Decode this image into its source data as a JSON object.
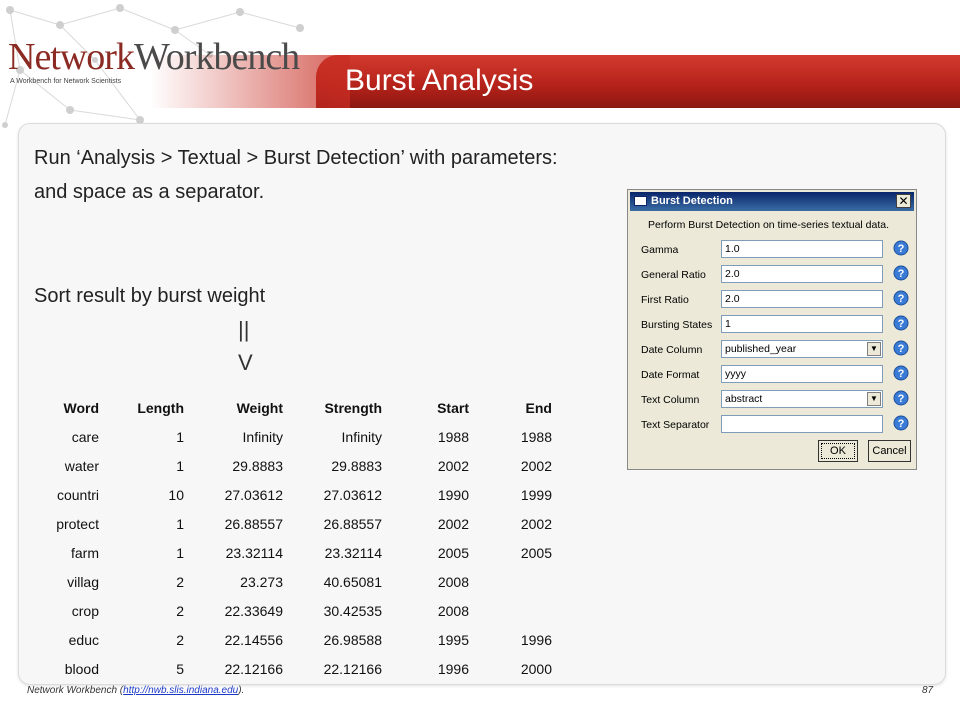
{
  "header": {
    "brand_part_a": "Network",
    "brand_part_b": "Workbench",
    "brand_tagline": "A Workbench for Network Scientists",
    "slide_title": "Burst Analysis"
  },
  "content": {
    "line1": "Run ‘Analysis > Textual > Burst Detection’ with parameters:",
    "line2": "and space as a separator.",
    "line3": "Sort result by burst weight",
    "arrow_top": "||",
    "arrow_bottom": "V"
  },
  "table": {
    "columns": [
      "Word",
      "Length",
      "Weight",
      "Strength",
      "Start",
      "End"
    ],
    "rows": [
      [
        "care",
        "1",
        "Infinity",
        "Infinity",
        "1988",
        "1988"
      ],
      [
        "water",
        "1",
        "29.8883",
        "29.8883",
        "2002",
        "2002"
      ],
      [
        "countri",
        "10",
        "27.03612",
        "27.03612",
        "1990",
        "1999"
      ],
      [
        "protect",
        "1",
        "26.88557",
        "26.88557",
        "2002",
        "2002"
      ],
      [
        "farm",
        "1",
        "23.32114",
        "23.32114",
        "2005",
        "2005"
      ],
      [
        "villag",
        "2",
        "23.273",
        "40.65081",
        "2008",
        ""
      ],
      [
        "crop",
        "2",
        "22.33649",
        "30.42535",
        "2008",
        ""
      ],
      [
        "educ",
        "2",
        "22.14556",
        "26.98588",
        "1995",
        "1996"
      ],
      [
        "blood",
        "5",
        "22.12166",
        "22.12166",
        "1996",
        "2000"
      ]
    ]
  },
  "dialog": {
    "title": "Burst Detection",
    "close_glyph": "✕",
    "description": "Perform Burst Detection on time-series textual data.",
    "params": [
      {
        "label": "Gamma",
        "value": "1.0",
        "type": "text"
      },
      {
        "label": "General Ratio",
        "value": "2.0",
        "type": "text"
      },
      {
        "label": "First Ratio",
        "value": "2.0",
        "type": "text"
      },
      {
        "label": "Bursting States",
        "value": "1",
        "type": "text"
      },
      {
        "label": "Date Column",
        "value": "published_year",
        "type": "select"
      },
      {
        "label": "Date Format",
        "value": "yyyy",
        "type": "text"
      },
      {
        "label": "Text Column",
        "value": "abstract",
        "type": "select"
      },
      {
        "label": "Text Separator",
        "value": "",
        "type": "text"
      }
    ],
    "ok_label": "OK",
    "cancel_label": "Cancel"
  },
  "footer": {
    "prefix": "Network Workbench (",
    "link_text": "http://nwb.slis.indiana.edu",
    "suffix": ").",
    "page_number": "87"
  },
  "colors": {
    "title_bar": "#b7231b",
    "brand_red": "#8a2a22",
    "dialog_titlebar": "#0a246a",
    "dialog_face": "#ece9d8",
    "help_icon": "#3a7bd5"
  }
}
